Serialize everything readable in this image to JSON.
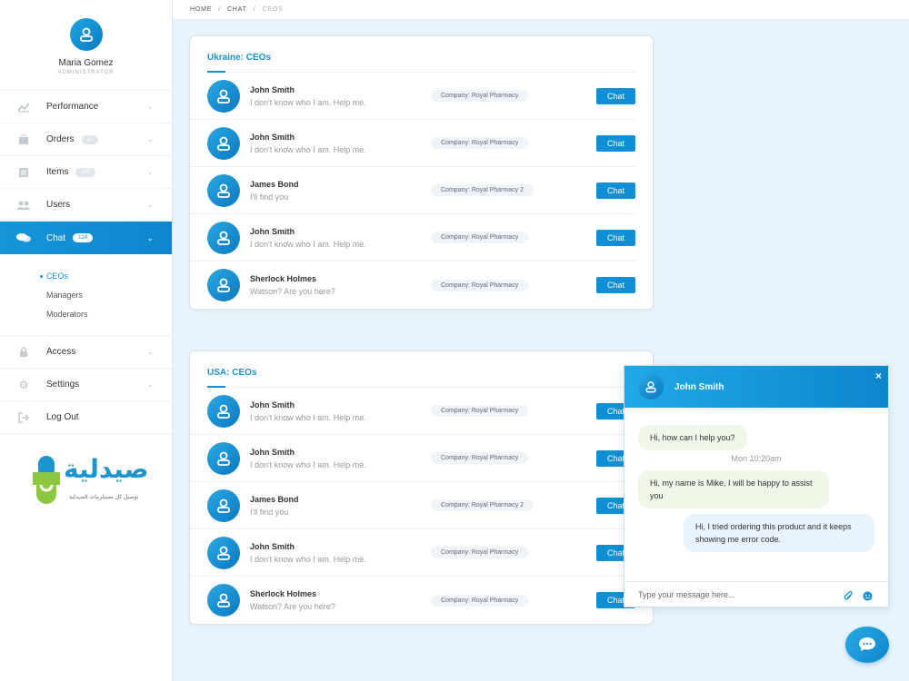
{
  "profile": {
    "name": "Maria Gomez",
    "role": "ADMINISTRATOR"
  },
  "nav": [
    {
      "label": "Performance",
      "icon": "chart-icon",
      "badge": ""
    },
    {
      "label": "Orders",
      "icon": "orders-icon",
      "badge": "12"
    },
    {
      "label": "Items",
      "icon": "items-icon",
      "badge": "200"
    },
    {
      "label": "Users",
      "icon": "users-icon",
      "badge": ""
    },
    {
      "label": "Chat",
      "icon": "chat-icon",
      "badge": "124"
    }
  ],
  "subnav": [
    "CEOs",
    "Managers",
    "Moderators"
  ],
  "nav_bottom": [
    {
      "label": "Access",
      "icon": "lock-icon"
    },
    {
      "label": "Settings",
      "icon": "gear-icon"
    },
    {
      "label": "Log Out",
      "icon": "logout-icon"
    }
  ],
  "logo": {
    "text": "صيدلية",
    "sub": "توصيل كل مستلزمات الصيدلية"
  },
  "breadcrumb": {
    "home": "HOME",
    "chat": "CHAT",
    "current": "CEOS"
  },
  "sections": [
    {
      "title": "Ukraine: CEOs",
      "rows": [
        {
          "name": "John Smith",
          "message": "I don't know who I am. Help me.",
          "company": "Company: Royal Pharmacy",
          "action": "Chat"
        },
        {
          "name": "John Smith",
          "message": "I don't know who I am. Help me.",
          "company": "Company: Royal Pharmacy",
          "action": "Chat"
        },
        {
          "name": "James Bond",
          "message": "I'll find you",
          "company": "Company: Royal Pharmacy 2",
          "action": "Chat"
        },
        {
          "name": "John Smith",
          "message": "I don't know who I am. Help me.",
          "company": "Company: Royal Pharmacy",
          "action": "Chat"
        },
        {
          "name": "Sherlock Holmes",
          "message": "Watson? Are you here?",
          "company": "Company: Royal Pharmacy",
          "action": "Chat"
        }
      ]
    },
    {
      "title": "USA: CEOs",
      "rows": [
        {
          "name": "John Smith",
          "message": "I don't know who I am. Help me.",
          "company": "Company: Royal Pharmacy",
          "action": "Chat"
        },
        {
          "name": "John Smith",
          "message": "I don't know who I am. Help me.",
          "company": "Company: Royal Pharmacy",
          "action": "Chat"
        },
        {
          "name": "James Bond",
          "message": "I'll find you",
          "company": "Company: Royal Pharmacy 2",
          "action": "Chat"
        },
        {
          "name": "John Smith",
          "message": "I don't know who I am. Help me.",
          "company": "Company: Royal Pharmacy",
          "action": "Chat"
        },
        {
          "name": "Sherlock Holmes",
          "message": "Watson? Are you here?",
          "company": "Company: Royal Pharmacy",
          "action": "Chat"
        }
      ]
    }
  ],
  "chat_window": {
    "name": "John Smith",
    "close": "×",
    "messages": [
      {
        "text": "Hi, how can I help you?"
      },
      {
        "text": "Mon 10:20am"
      },
      {
        "text": "Hi, my name is Mike, I will be happy to assist you"
      },
      {
        "text": "Hi, I tried ordering this product and it keeps showing me error code."
      }
    ],
    "placeholder": "Type your message here..."
  },
  "colors": {
    "accent": "#0f90d5",
    "background": "#e6f4fb",
    "incoming": "#eef7e8",
    "outgoing": "#e8f3fb"
  }
}
